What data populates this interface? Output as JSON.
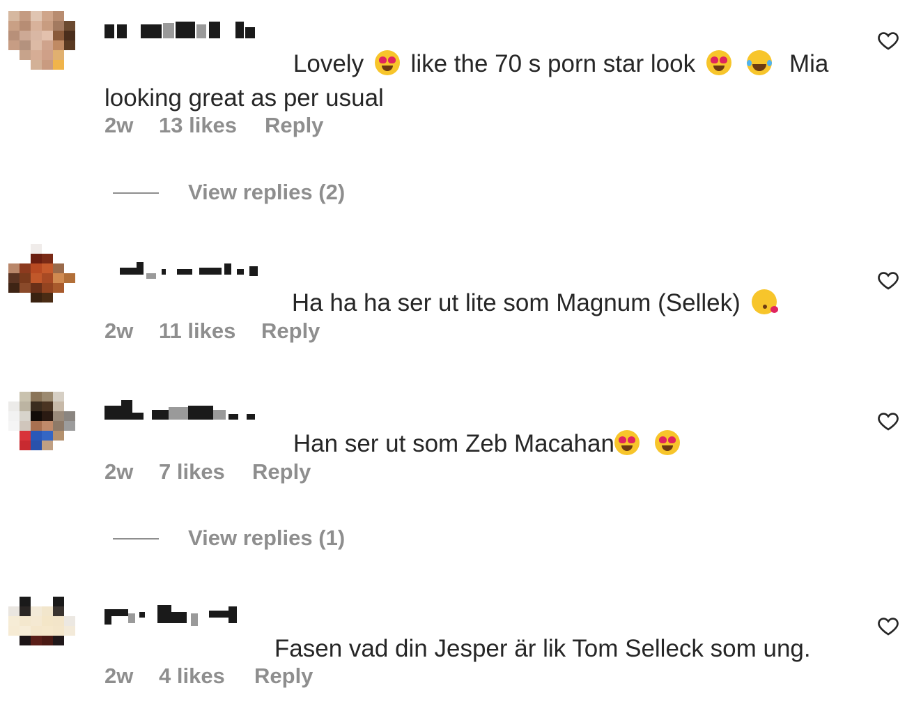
{
  "comments": [
    {
      "text_parts": [
        "Lovely ",
        " like the 70 s porn star look ",
        " ",
        "  Mia",
        "looking great as per usual"
      ],
      "emojis": [
        "heart-eyes-emoji",
        "heart-eyes-emoji",
        "laughing-emoji"
      ],
      "time": "2w",
      "likes": "13 likes",
      "reply_label": "Reply",
      "view_replies": "View replies (2)"
    },
    {
      "text_parts": [
        "Ha ha ha ser ut lite som Magnum (Sellek) "
      ],
      "emojis": [
        "kiss-emoji"
      ],
      "time": "2w",
      "likes": "11 likes",
      "reply_label": "Reply"
    },
    {
      "text_parts": [
        "Han ser ut som Zeb Macahan",
        " "
      ],
      "emojis": [
        "heart-eyes-emoji",
        "heart-eyes-emoji"
      ],
      "time": "2w",
      "likes": "7 likes",
      "reply_label": "Reply",
      "view_replies": "View replies (1)"
    },
    {
      "text_parts": [
        "Fasen vad din Jesper är lik Tom Selleck som ung."
      ],
      "emojis": [],
      "time": "2w",
      "likes": "4 likes",
      "reply_label": "Reply"
    }
  ],
  "icons": {
    "like": "heart-outline-icon",
    "avatar": "pixelated-avatar",
    "username": "pixelated-username"
  },
  "colors": {
    "text": "#262626",
    "meta": "#8e8e8e",
    "background": "#ffffff"
  }
}
